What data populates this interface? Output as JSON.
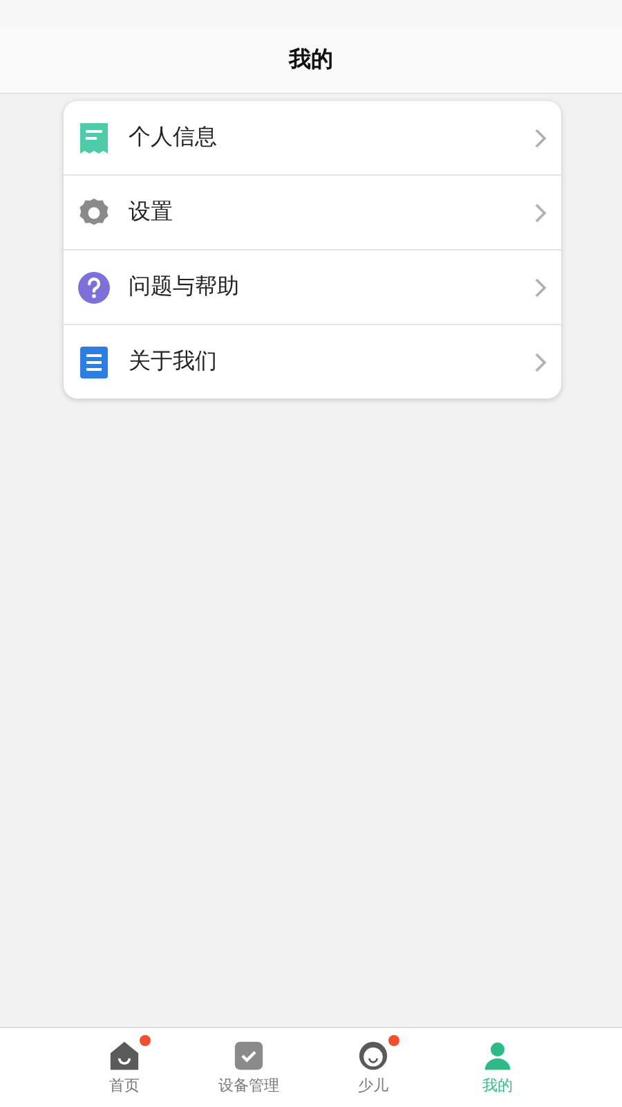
{
  "header": {
    "title": "我的"
  },
  "menu": [
    {
      "kind": "profile",
      "label": "个人信息"
    },
    {
      "kind": "settings",
      "label": "设置"
    },
    {
      "kind": "help",
      "label": "问题与帮助"
    },
    {
      "kind": "about",
      "label": "关于我们"
    }
  ],
  "tabs": [
    {
      "kind": "home",
      "label": "首页",
      "selected": false,
      "badge": true
    },
    {
      "kind": "device",
      "label": "设备管理",
      "selected": false,
      "badge": false
    },
    {
      "kind": "child",
      "label": "少儿",
      "selected": false,
      "badge": true
    },
    {
      "kind": "me",
      "label": "我的",
      "selected": true,
      "badge": false
    }
  ]
}
